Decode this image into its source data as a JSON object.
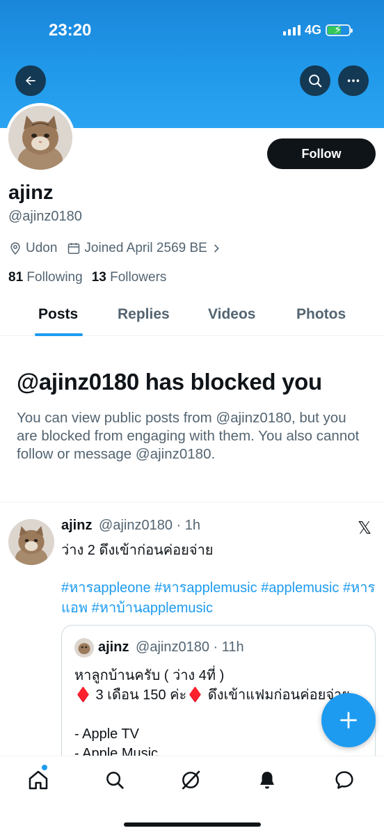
{
  "status_bar": {
    "time": "23:20",
    "network": "4G"
  },
  "profile": {
    "display_name": "ajinz",
    "handle": "@ajinz0180",
    "location": "Udon",
    "joined": "Joined April 2569 BE",
    "following_count": "81",
    "following_label": "Following",
    "followers_count": "13",
    "followers_label": "Followers",
    "follow_label": "Follow"
  },
  "tabs": [
    {
      "label": "Posts",
      "active": true
    },
    {
      "label": "Replies",
      "active": false
    },
    {
      "label": "Videos",
      "active": false
    },
    {
      "label": "Photos",
      "active": false
    }
  ],
  "blocked": {
    "title": "@ajinz0180 has blocked you",
    "description": "You can view public posts from @ajinz0180, but you are blocked from engaging with them. You also cannot follow or message @ajinz0180."
  },
  "post": {
    "author": "ajinz",
    "handle": "@ajinz0180",
    "time": "· 1h",
    "text": "ว่าง 2 ดึงเข้าก่อนค่อยจ่าย",
    "hashtags": "#หารappleone #หารapplemusic #applemusic #หารแอพ #หาบ้านapplemusic",
    "quote": {
      "author": "ajinz",
      "handle": "@ajinz0180",
      "time": "· 11h",
      "lines": [
        "หาลูกบ้านครับ ( ว่าง 4ที่ )",
        "♦️ 3 เดือน 150 ค่ะ♦️ ดึงเข้าแฟมก่อนค่อยจ่าย",
        "",
        "- Apple TV",
        "- Apple Music"
      ]
    }
  },
  "icons": {
    "back": "arrow-left-icon",
    "search": "search-icon",
    "more": "more-icon",
    "location": "location-pin-icon",
    "calendar": "calendar-icon",
    "x_logo": "x-logo-icon",
    "compose": "plus-icon",
    "nav": [
      "home-icon",
      "search-icon",
      "grok-icon",
      "bell-icon",
      "message-icon"
    ]
  },
  "colors": {
    "accent": "#1d9bf0",
    "text": "#0f1419",
    "secondary": "#536471",
    "banner": "#2199ea"
  }
}
